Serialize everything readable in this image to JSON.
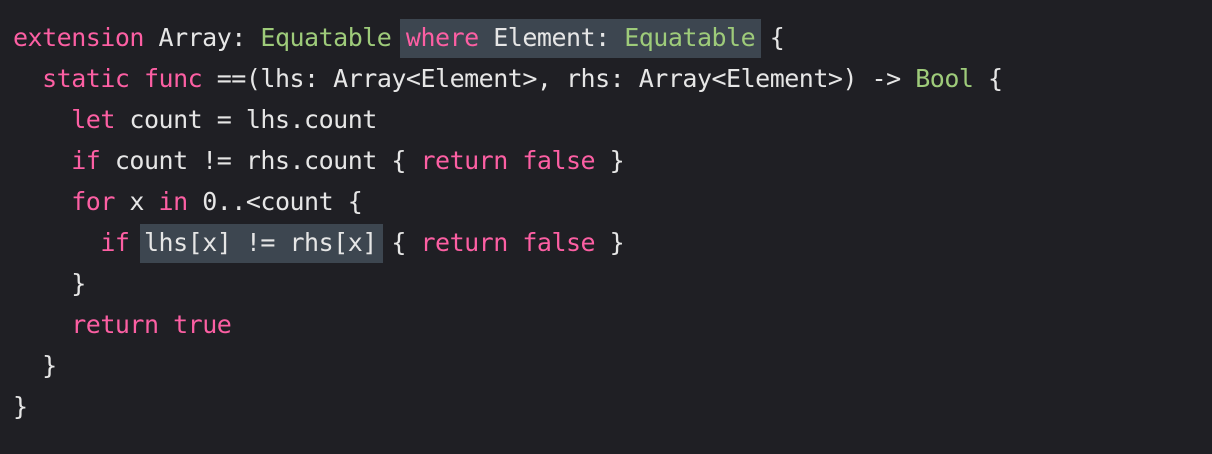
{
  "code": {
    "line1": {
      "kw_extension": "extension",
      "array": " Array: ",
      "equatable1": "Equatable",
      "space": " ",
      "kw_where": "where",
      "element": " Element: ",
      "equatable2": "Equatable",
      "brace": " {"
    },
    "line2": {
      "indent": "  ",
      "kw_static": "static",
      "space": " ",
      "kw_func": "func",
      "signature": " ==(lhs: Array<Element>, rhs: Array<Element>) -> ",
      "bool": "Bool",
      "brace": " {"
    },
    "line3": {
      "indent": "    ",
      "kw_let": "let",
      "rest": " count = lhs.count"
    },
    "line4": {
      "indent": "    ",
      "kw_if": "if",
      "cond": " count != rhs.count { ",
      "kw_return": "return",
      "space": " ",
      "kw_false": "false",
      "close": " }"
    },
    "line5": {
      "indent": "    ",
      "kw_for": "for",
      "mid": " x ",
      "kw_in": "in",
      "rest": " 0..<count {"
    },
    "line6": {
      "indent": "      ",
      "kw_if": "if",
      "space": " ",
      "cond": "lhs[x] != rhs[x]",
      "open": " { ",
      "kw_return": "return",
      "space2": " ",
      "kw_false": "false",
      "close": " }"
    },
    "line7": {
      "indent": "    ",
      "brace": "}"
    },
    "line8": {
      "indent": "    ",
      "kw_return": "return",
      "space": " ",
      "kw_true": "true"
    },
    "line9": {
      "indent": "  ",
      "brace": "}"
    },
    "line10": {
      "brace": "}"
    }
  },
  "colors": {
    "background": "#1f1f24",
    "keyword": "#fc5fa3",
    "type": "#9ecb7a",
    "plain": "#e6e6e6",
    "highlight": "#3d4650"
  }
}
